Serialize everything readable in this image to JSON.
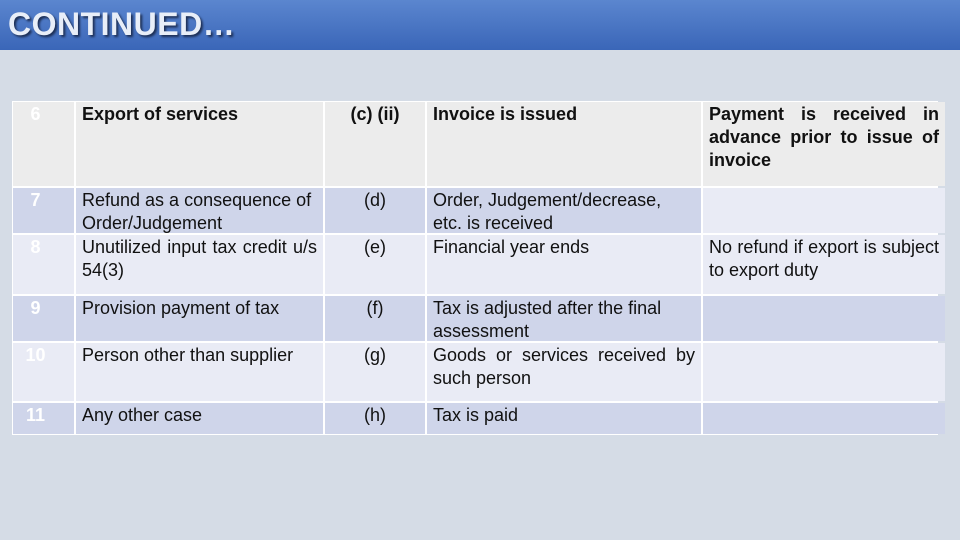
{
  "header": {
    "title": "CONTINUED…"
  },
  "colors": {
    "accent": "#4472c4",
    "row_dark": "#cfd5ea",
    "row_light": "#e9ebf5"
  },
  "rows": [
    {
      "no": "6",
      "case": "Export of services",
      "clause": "(c) (ii)",
      "event": "Invoice is issued",
      "condition": "Payment is received in advance prior to issue of invoice"
    },
    {
      "no": "7",
      "case": "Refund as a consequence of Order/Judgement",
      "clause": "(d)",
      "event": "Order, Judgement/decrease, etc. is received",
      "condition": ""
    },
    {
      "no": "8",
      "case": "Unutilized input tax credit u/s 54(3)",
      "clause": "(e)",
      "event": "Financial year ends",
      "condition": "No refund if export is subject to export duty"
    },
    {
      "no": "9",
      "case": "Provision payment of tax",
      "clause": "(f)",
      "event": "Tax is adjusted after the final assessment",
      "condition": ""
    },
    {
      "no": "10",
      "case": "Person other than supplier",
      "clause": "(g)",
      "event": "Goods or services received by such person",
      "condition": ""
    },
    {
      "no": "11",
      "case": "Any other case",
      "clause": "(h)",
      "event": "Tax is paid",
      "condition": ""
    }
  ]
}
